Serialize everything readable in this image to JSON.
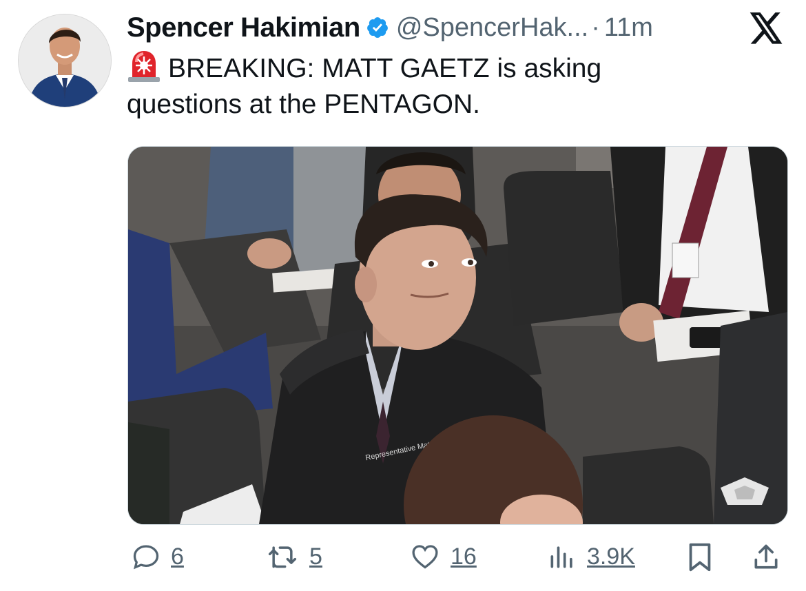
{
  "tweet": {
    "author_name": "Spencer Hakimian",
    "handle": "@SpencerHak...",
    "separator": "·",
    "time": "11m",
    "text_line1": "BREAKING: MATT GAETZ is asking",
    "text_line2": "questions at the PENTAGON.",
    "media_jacket_text": "Representative Matt Gaetz"
  },
  "actions": {
    "replies": "6",
    "reposts": "5",
    "likes": "16",
    "views": "3.9K"
  },
  "icons": {
    "verified": "verified-badge-icon",
    "platform": "x-logo-icon",
    "siren": "rotating-light-icon",
    "reply": "speech-bubble-icon",
    "repost": "repost-arrows-icon",
    "like": "heart-icon",
    "views": "bar-chart-icon",
    "bookmark": "bookmark-icon",
    "share": "share-upload-icon"
  },
  "colors": {
    "verified_blue": "#1d9bf0",
    "text": "#0f1419",
    "muted": "#536471",
    "siren_red": "#e0242b"
  }
}
